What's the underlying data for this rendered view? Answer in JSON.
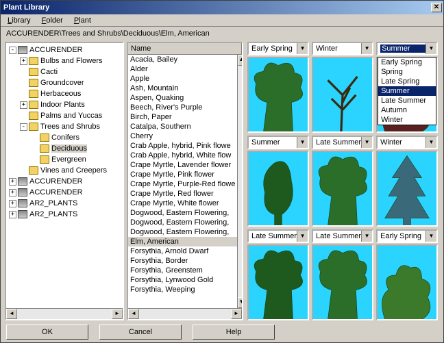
{
  "window": {
    "title": "Plant Library"
  },
  "menu": {
    "library": "Library",
    "folder": "Folder",
    "plant": "Plant"
  },
  "path": "ACCURENDER\\Trees and Shrubs\\Deciduous\\Elm, American",
  "list_header": "Name",
  "tree": {
    "items": [
      {
        "exp": "-",
        "icon": "book",
        "label": "ACCURENDER",
        "indent": 0
      },
      {
        "exp": "+",
        "icon": "folder",
        "label": "Bulbs and Flowers",
        "indent": 1
      },
      {
        "exp": "",
        "icon": "folder",
        "label": "Cacti",
        "indent": 1
      },
      {
        "exp": "",
        "icon": "folder",
        "label": "Groundcover",
        "indent": 1
      },
      {
        "exp": "",
        "icon": "folder",
        "label": "Herbaceous",
        "indent": 1
      },
      {
        "exp": "+",
        "icon": "folder",
        "label": "Indoor Plants",
        "indent": 1
      },
      {
        "exp": "",
        "icon": "folder",
        "label": "Palms and Yuccas",
        "indent": 1
      },
      {
        "exp": "-",
        "icon": "folder",
        "label": "Trees and Shrubs",
        "indent": 1
      },
      {
        "exp": "",
        "icon": "folder",
        "label": "Conifers",
        "indent": 2
      },
      {
        "exp": "",
        "icon": "folder",
        "label": "Deciduous",
        "indent": 2,
        "sel": true
      },
      {
        "exp": "",
        "icon": "folder",
        "label": "Evergreen",
        "indent": 2
      },
      {
        "exp": "",
        "icon": "folder",
        "label": "Vines and Creepers",
        "indent": 1
      },
      {
        "exp": "+",
        "icon": "book",
        "label": "ACCURENDER",
        "indent": 0
      },
      {
        "exp": "+",
        "icon": "book",
        "label": "ACCURENDER",
        "indent": 0
      },
      {
        "exp": "+",
        "icon": "book",
        "label": "AR2_PLANTS",
        "indent": 0
      },
      {
        "exp": "+",
        "icon": "book",
        "label": "AR2_PLANTS",
        "indent": 0
      }
    ]
  },
  "list": {
    "items": [
      "Acacia, Bailey",
      "Alder",
      "Apple",
      "Ash, Mountain",
      "Aspen, Quaking",
      "Beech, River's Purple",
      "Birch, Paper",
      "Catalpa, Southern",
      "Cherry",
      "Crab Apple, hybrid, Pink flowe",
      "Crab Apple, hybrid, White flow",
      "Crape Myrtle, Lavender flower",
      "Crape Myrtle, Pink flower",
      "Crape Myrtle, Purple-Red flowe",
      "Crape Myrtle, Red flower",
      "Crape Myrtle, White flower",
      "Dogwood, Eastern Flowering,",
      "Dogwood, Eastern Flowering,",
      "Dogwood, Eastern Flowering,",
      "Elm, American",
      "Forsythia, Arnold Dwarf",
      "Forsythia, Border",
      "Forsythia, Greenstem",
      "Forsythia, Lynwood Gold",
      "Forsythia, Weeping"
    ],
    "selected_index": 19
  },
  "previews": [
    {
      "season": "Early Spring"
    },
    {
      "season": "Winter"
    },
    {
      "season": "Summer",
      "open": true
    },
    {
      "season": "Summer"
    },
    {
      "season": "Late Summer"
    },
    {
      "season": "Winter"
    },
    {
      "season": "Late Summer"
    },
    {
      "season": "Late Summer"
    },
    {
      "season": "Early Spring"
    }
  ],
  "dropdown_options": [
    "Early Spring",
    "Spring",
    "Late Spring",
    "Summer",
    "Late Summer",
    "Autumn",
    "Winter"
  ],
  "dropdown_selected": "Summer",
  "buttons": {
    "ok": "OK",
    "cancel": "Cancel",
    "help": "Help"
  }
}
